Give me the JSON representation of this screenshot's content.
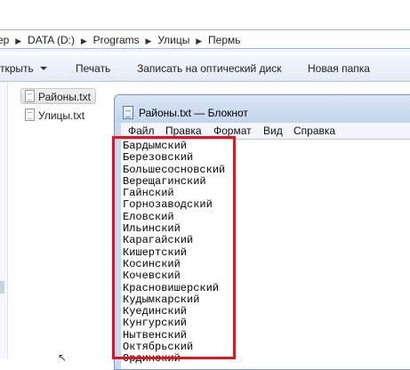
{
  "explorer": {
    "breadcrumb": [
      {
        "label": "ер"
      },
      {
        "label": "DATA (D:)"
      },
      {
        "label": "Programs"
      },
      {
        "label": "Улицы"
      },
      {
        "label": "Пермь"
      }
    ],
    "breadcrumb_separator": "▶",
    "toolbar": {
      "open_label": "ткрыть",
      "print_label": "Печать",
      "burn_label": "Записать на оптический диск",
      "new_folder_label": "Новая папка"
    },
    "files": [
      {
        "name": "Районы.txt",
        "selected": true
      },
      {
        "name": "Улицы.txt",
        "selected": false
      }
    ]
  },
  "notepad": {
    "title": "Районы.txt — Блокнот",
    "menu": [
      "Файл",
      "Правка",
      "Формат",
      "Вид",
      "Справка"
    ],
    "lines": [
      "Бардымский",
      "Березовский",
      "Большесосновский",
      "Верещагинский",
      "Гайнский",
      "Горнозаводский",
      "Еловский",
      "Ильинский",
      "Карагайский",
      "Кишертский",
      "Косинский",
      "Кочевский",
      "Красновишерский",
      "Кудымкарский",
      "Куединский",
      "Кунгурский",
      "Нытвенский",
      "Октябрьский",
      "Ординский"
    ]
  },
  "highlight": {
    "color": "#e3141e"
  }
}
